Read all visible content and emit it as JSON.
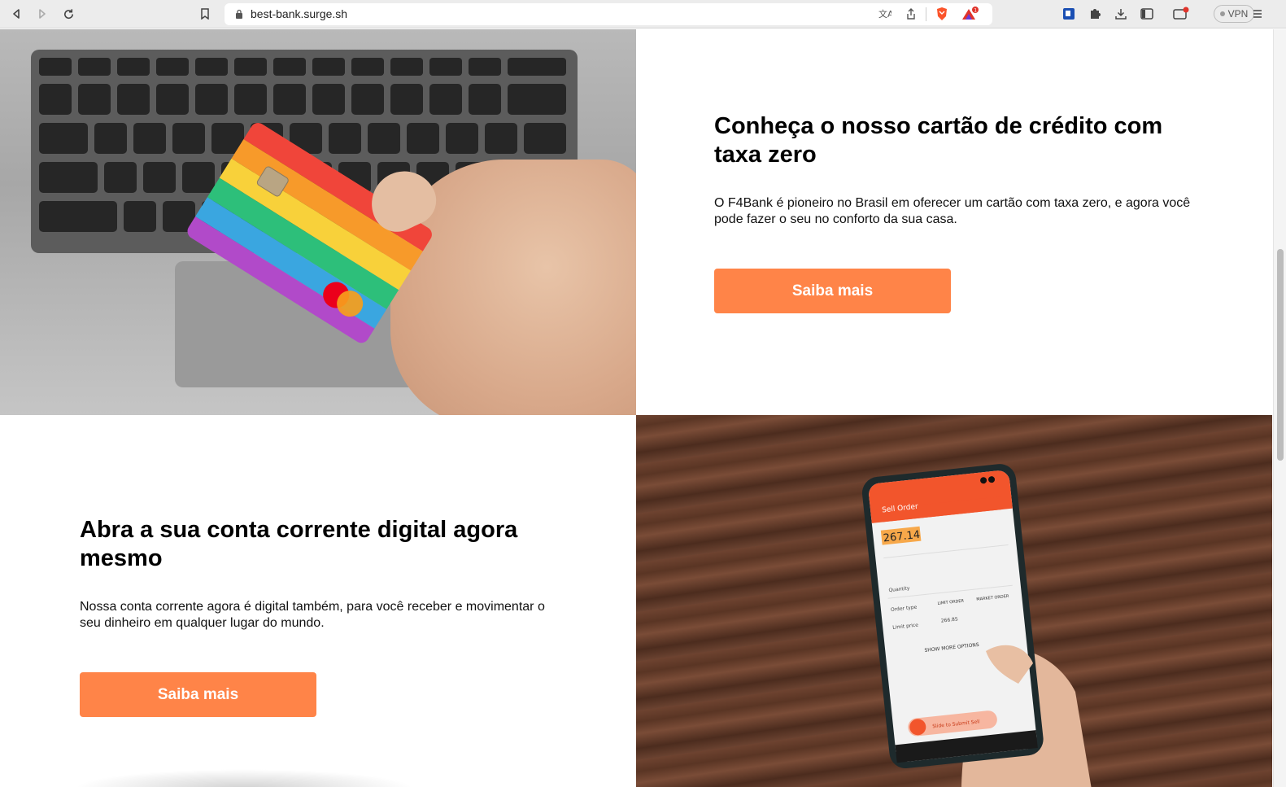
{
  "browser": {
    "url": "best-bank.surge.sh",
    "vpn_label": "VPN",
    "brave_badge": "1"
  },
  "sections": [
    {
      "heading": "Conheça o nosso cartão de crédito com taxa zero",
      "description": "O F4Bank é pioneiro no Brasil em oferecer um cartão com taxa zero, e agora você pode fazer o seu no conforto da sua casa.",
      "button_label": "Saiba mais",
      "image_alt": "credit-card-in-hand-over-laptop"
    },
    {
      "heading": "Abra a sua conta corrente digital agora mesmo",
      "description": "Nossa conta corrente agora é digital também, para você receber e movimentar o seu dinheiro em qualquer lugar do mundo.",
      "button_label": "Saiba mais",
      "image_alt": "smartphone-trading-app-on-wood-table"
    }
  ],
  "phone_screen": {
    "title": "Sell Order",
    "price": "267.14",
    "quantity_label": "Quantity",
    "order_type_label": "Order type",
    "limit_order": "LIMIT ORDER",
    "market_order": "MARKET ORDER",
    "limit_price_label": "Limit price",
    "limit_price": "266.85",
    "show_more": "SHOW MORE OPTIONS",
    "slide_label": "Slide to Submit Sell"
  },
  "colors": {
    "accent": "#ff8448",
    "heading": "#000000"
  }
}
